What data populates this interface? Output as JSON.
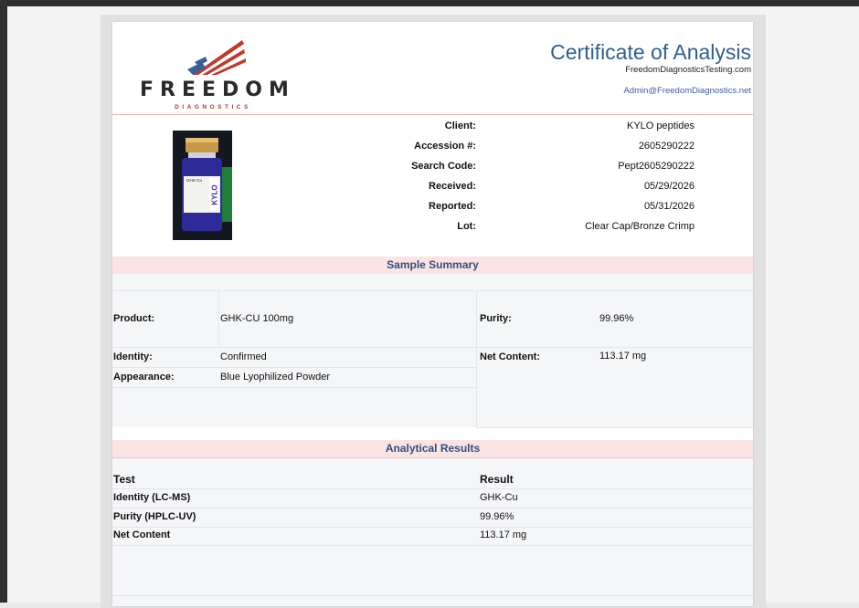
{
  "header": {
    "brand_name": "FREEDOM",
    "brand_sub": "DIAGNOSTICS",
    "title": "Certificate of Analysis",
    "website": "FreedomDiagnosticsTesting.com",
    "email": "Admin@FreedomDiagnostics.net"
  },
  "vial": {
    "label_product": "GHK-Cu",
    "label_brand": "KYLO"
  },
  "client_info": {
    "client_label": "Client:",
    "client_value": "KYLO peptides",
    "accession_label": "Accession #:",
    "accession_value": "2605290222",
    "search_label": "Search Code:",
    "search_value": "Pept2605290222",
    "received_label": "Received:",
    "received_value": "05/29/2026",
    "reported_label": "Reported:",
    "reported_value": "05/31/2026",
    "lot_label": "Lot:",
    "lot_value": "Clear Cap/Bronze Crimp"
  },
  "sample_summary": {
    "heading": "Sample Summary",
    "product_label": "Product:",
    "product_value": "GHK-CU 100mg",
    "purity_label": "Purity:",
    "purity_value": "99.96%",
    "identity_label": "Identity:",
    "identity_value": "Confirmed",
    "net_content_label": "Net Content:",
    "net_content_value": "113.17 mg",
    "appearance_label": "Appearance:",
    "appearance_value": "Blue Lyophilized Powder"
  },
  "analytical_results": {
    "heading": "Analytical Results",
    "col_test": "Test",
    "col_result": "Result",
    "rows": [
      {
        "test": "Identity (LC-MS)",
        "result": "GHK-Cu"
      },
      {
        "test": "Purity (HPLC-UV)",
        "result": "99.96%"
      },
      {
        "test": "Net Content",
        "result": "113.17 mg"
      }
    ]
  },
  "colors": {
    "title_blue": "#2f5f8f",
    "section_bg": "#fbe3e3",
    "accent_red": "#c0392b"
  }
}
